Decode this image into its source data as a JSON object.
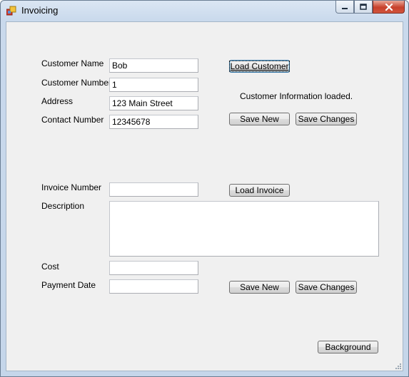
{
  "window": {
    "title": "Invoicing",
    "icon": "app-form-icon",
    "controls": [
      "minimize-icon",
      "maximize-icon",
      "close-icon"
    ]
  },
  "customer": {
    "name_label": "Customer Name",
    "name_value": "Bob",
    "number_label": "Customer Number",
    "number_value": "1",
    "address_label": "Address",
    "address_value": "123 Main Street",
    "contact_label": "Contact Number",
    "contact_value": "12345678",
    "load_button": "Load Customer",
    "status": "Customer Information loaded.",
    "save_new_button": "Save New",
    "save_changes_button": "Save Changes"
  },
  "invoice": {
    "number_label": "Invoice Number",
    "number_value": "",
    "load_button": "Load Invoice",
    "description_label": "Description",
    "description_value": "",
    "cost_label": "Cost",
    "cost_value": "",
    "payment_date_label": "Payment Date",
    "payment_date_value": "",
    "save_new_button": "Save New",
    "save_changes_button": "Save Changes"
  },
  "footer": {
    "background_button": "Background"
  },
  "colors": {
    "frame": "#c5d6ea",
    "client": "#f0f0f0",
    "close": "#c7402b"
  }
}
